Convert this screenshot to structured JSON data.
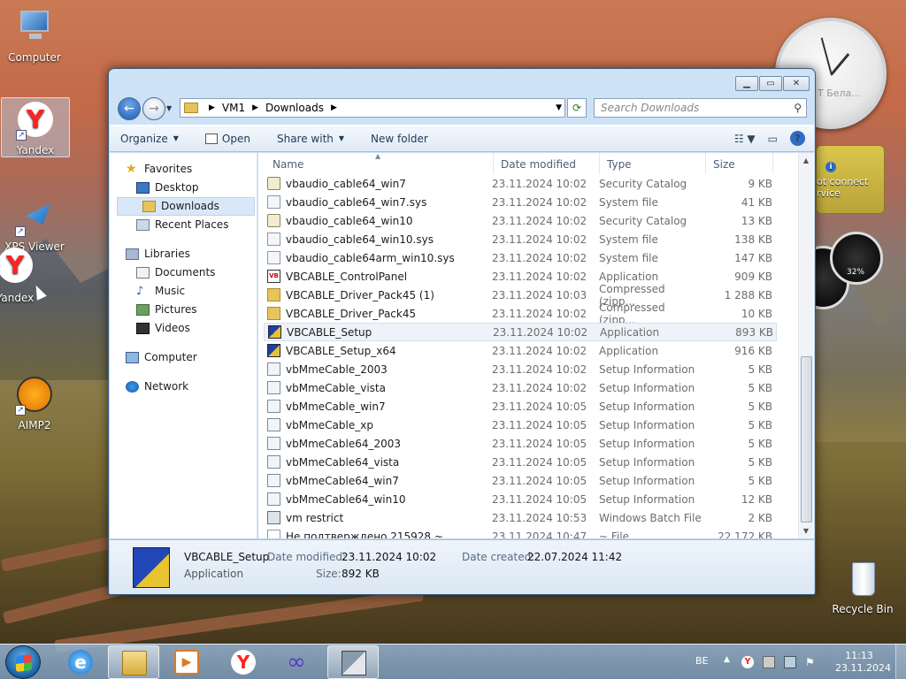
{
  "desktop": {
    "icons": [
      {
        "label": "Computer"
      },
      {
        "label": "Yandex"
      },
      {
        "label": "XPS Viewer"
      },
      {
        "label": "Yandex"
      },
      {
        "label": "AIMP2"
      },
      {
        "label": "Recycle Bin"
      }
    ],
    "gadgets": {
      "clock_label": "T Бела...",
      "weather_text": "ot connect rvice",
      "cpu_percent": "32%"
    }
  },
  "window": {
    "breadcrumb": [
      "VM1",
      "Downloads"
    ],
    "search_placeholder": "Search Downloads",
    "toolbar": {
      "organize": "Organize",
      "open": "Open",
      "share_with": "Share with",
      "new_folder": "New folder"
    },
    "nav": {
      "favorites": "Favorites",
      "favorites_items": [
        "Desktop",
        "Downloads",
        "Recent Places"
      ],
      "libraries": "Libraries",
      "libraries_items": [
        "Documents",
        "Music",
        "Pictures",
        "Videos"
      ],
      "computer": "Computer",
      "network": "Network"
    },
    "columns": {
      "name": "Name",
      "date_modified": "Date modified",
      "type": "Type",
      "size": "Size"
    },
    "files": [
      {
        "name": "vbaudio_cable64_win7",
        "date": "23.11.2024 10:02",
        "type": "Security Catalog",
        "size": "9 KB",
        "icon": "catalog-icon"
      },
      {
        "name": "vbaudio_cable64_win7.sys",
        "date": "23.11.2024 10:02",
        "type": "System file",
        "size": "41 KB",
        "icon": "system-file-icon"
      },
      {
        "name": "vbaudio_cable64_win10",
        "date": "23.11.2024 10:02",
        "type": "Security Catalog",
        "size": "13 KB",
        "icon": "catalog-icon"
      },
      {
        "name": "vbaudio_cable64_win10.sys",
        "date": "23.11.2024 10:02",
        "type": "System file",
        "size": "138 KB",
        "icon": "system-file-icon"
      },
      {
        "name": "vbaudio_cable64arm_win10.sys",
        "date": "23.11.2024 10:02",
        "type": "System file",
        "size": "147 KB",
        "icon": "system-file-icon"
      },
      {
        "name": "VBCABLE_ControlPanel",
        "date": "23.11.2024 10:02",
        "type": "Application",
        "size": "909 KB",
        "icon": "vb-app-icon"
      },
      {
        "name": "VBCABLE_Driver_Pack45 (1)",
        "date": "23.11.2024 10:03",
        "type": "Compressed (zipp...",
        "size": "1 288 KB",
        "icon": "zip-folder-icon"
      },
      {
        "name": "VBCABLE_Driver_Pack45",
        "date": "23.11.2024 10:02",
        "type": "Compressed (zipp...",
        "size": "10 KB",
        "icon": "zip-folder-icon"
      },
      {
        "name": "VBCABLE_Setup",
        "date": "23.11.2024 10:02",
        "type": "Application",
        "size": "893 KB",
        "icon": "setup-icon",
        "selected": true
      },
      {
        "name": "VBCABLE_Setup_x64",
        "date": "23.11.2024 10:02",
        "type": "Application",
        "size": "916 KB",
        "icon": "setup-icon"
      },
      {
        "name": "vbMmeCable_2003",
        "date": "23.11.2024 10:02",
        "type": "Setup Information",
        "size": "5 KB",
        "icon": "inf-file-icon"
      },
      {
        "name": "vbMmeCable_vista",
        "date": "23.11.2024 10:02",
        "type": "Setup Information",
        "size": "5 KB",
        "icon": "inf-file-icon"
      },
      {
        "name": "vbMmeCable_win7",
        "date": "23.11.2024 10:05",
        "type": "Setup Information",
        "size": "5 KB",
        "icon": "inf-file-icon"
      },
      {
        "name": "vbMmeCable_xp",
        "date": "23.11.2024 10:05",
        "type": "Setup Information",
        "size": "5 KB",
        "icon": "inf-file-icon"
      },
      {
        "name": "vbMmeCable64_2003",
        "date": "23.11.2024 10:05",
        "type": "Setup Information",
        "size": "5 KB",
        "icon": "inf-file-icon"
      },
      {
        "name": "vbMmeCable64_vista",
        "date": "23.11.2024 10:05",
        "type": "Setup Information",
        "size": "5 KB",
        "icon": "inf-file-icon"
      },
      {
        "name": "vbMmeCable64_win7",
        "date": "23.11.2024 10:05",
        "type": "Setup Information",
        "size": "5 KB",
        "icon": "inf-file-icon"
      },
      {
        "name": "vbMmeCable64_win10",
        "date": "23.11.2024 10:05",
        "type": "Setup Information",
        "size": "12 KB",
        "icon": "inf-file-icon"
      },
      {
        "name": "vm restrict",
        "date": "23.11.2024 10:53",
        "type": "Windows Batch File",
        "size": "2 KB",
        "icon": "batch-file-icon"
      },
      {
        "name": "Не подтверждено 215928.~",
        "date": "23.11.2024 10:47",
        "type": "~ File",
        "size": "22 172 KB",
        "icon": "blank-file-icon"
      }
    ],
    "details": {
      "name": "VBCABLE_Setup",
      "type": "Application",
      "date_modified_label": "Date modified:",
      "date_modified": "23.11.2024 10:02",
      "date_created_label": "Date created:",
      "date_created": "22.07.2024 11:42",
      "size_label": "Size:",
      "size": "892 KB"
    }
  },
  "taskbar": {
    "language": "BE",
    "time": "11:13",
    "date": "23.11.2024"
  }
}
